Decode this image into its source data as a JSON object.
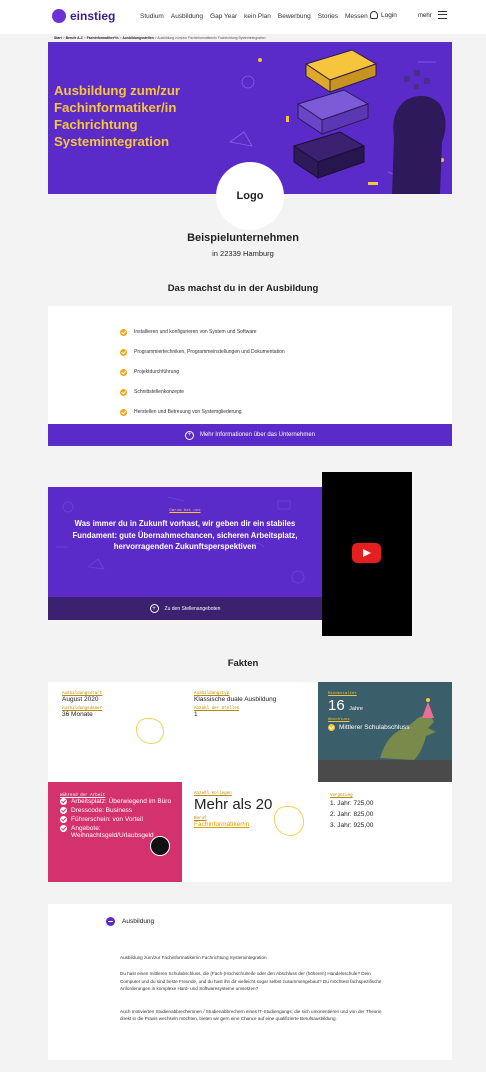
{
  "header": {
    "brand": "einstieg",
    "nav": [
      "Studium",
      "Ausbildung",
      "Gap Year",
      "kein Plan",
      "Bewerbung",
      "Stories",
      "Messen"
    ],
    "login": "Login",
    "more": "mehr",
    "icons": {
      "user": "user-icon",
      "menu": "hamburger-menu-icon"
    }
  },
  "breadcrumb": {
    "items": [
      "Start",
      "Berufe A-Z",
      "Fachinformatiker*in",
      "Ausbildungsstellen",
      "Ausbildung zum/zur Fachinformatiker/in Fachrichtung Systemintegration"
    ],
    "separator": " > "
  },
  "hero": {
    "title": "Ausbildung zum/zur Fachinformatiker/in Fachrichtung Systemintegration",
    "logo_text": "Logo"
  },
  "company": {
    "name": "Beispielunternehmen",
    "location": "in 22339 Hamburg"
  },
  "tasks": {
    "title": "Das machst du in der Ausbildung",
    "items": [
      "Installieren und konfigurieren von System und Software",
      "Programmiertechniken, Programmeinstellungen und Dokumentation",
      "Projektdurchführung",
      "Schnittstellenkonzepte",
      "Herstellen und Betreuung von Systemgliederung"
    ],
    "more_button": "Mehr Informationen über das Unternehmen"
  },
  "promo": {
    "kicker": "Darum bei uns",
    "text": "Was immer du in Zukunft vorhast, wir geben dir ein stabiles Fundament: gute Übernahmechancen, sicheren Arbeitsplatz, hervorragenden Zukunftsperspektiven",
    "button": "Zu den Stellenangeboten"
  },
  "facts": {
    "title": "Fakten",
    "start_label": "Ausbildungsstart",
    "start_value": "August 2020",
    "duration_label": "Ausbildungsdauer",
    "duration_value": "36 Monate",
    "type_label": "Ausbildungstyp",
    "type_value": "Klassische duale Ausbildung",
    "positions_label": "Anzahl der Stellen",
    "positions_value": "1",
    "min_age_label": "Mindestalter",
    "min_age_value": "16",
    "min_age_unit": "Jahre",
    "degree_label": "Abschluss",
    "degree_value": "Mittlerer Schulabschluss",
    "workplace_label": "Während der Arbeit",
    "workplace_items": [
      "Arbeitsplatz: Überwiegend im Büro",
      "Dresscode: Business",
      "Führerschein: von Vorteil",
      "Angebote: Weihnachtsgeld/Urlaubsgeld"
    ],
    "colleagues_label": "Anzahl Kollegen",
    "colleagues_value": "Mehr als 20",
    "job_label": "Beruf",
    "job_value": "Fachinformatiker/in",
    "pay_label": "Vergütung",
    "pay_items": [
      "1. Jahr: 725,00",
      "2. Jahr: 825,00",
      "3. Jahr: 925,00"
    ]
  },
  "accordion": {
    "title": "Ausbildung",
    "paragraphs": [
      "Ausbildung zum/zur Fachinformatiker/in Fachrichtung Systemintegration",
      "Du hast einen mittleren Schulabschluss, die (Fach-)Hochschulreife oder den Abschluss der (höheren) Handelsschule? Dein Computer und du sind beste Freunde, und du hast ihn dir vielleicht sogar selbst zusammengebaut? Du möchtest fachspezifische Anforderungen in komplexe Hard- und Softwaresysteme umsetzen?",
      "Auch motivierten Studienabbrechernnen / Studienabbrechern eines IT-Studiengangs, die sich umorientieren und von der Theorie direkt in die Praxis wechseln möchten, bieten wir gern eine Chance auf eine qualifizierte Berufsausbildung."
    ]
  },
  "colors": {
    "brand": "#5b2bc9",
    "accent": "#f6c53b",
    "pink": "#d3326f",
    "check": "#f0a51e",
    "play": "#e51f1f"
  }
}
